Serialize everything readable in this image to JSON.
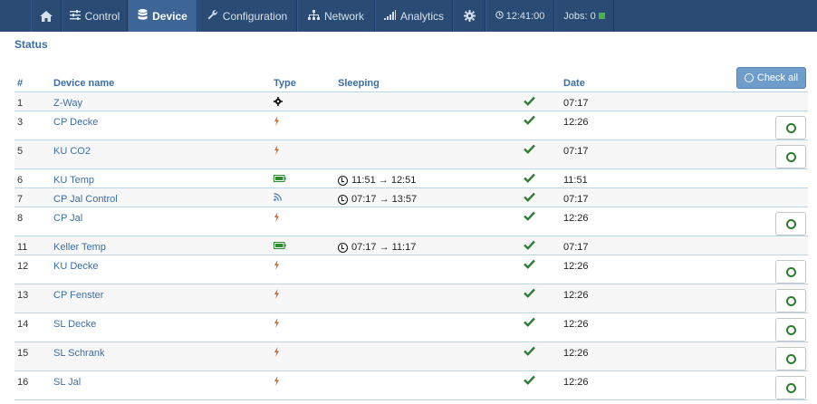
{
  "nav": {
    "home_icon": "home-icon",
    "items": [
      {
        "label": "Control",
        "icon": "sliders-icon"
      },
      {
        "label": "Device",
        "icon": "database-icon"
      },
      {
        "label": "Configuration",
        "icon": "wrench-icon"
      },
      {
        "label": "Network",
        "icon": "network-icon"
      },
      {
        "label": "Analytics",
        "icon": "signal-bars-icon"
      }
    ],
    "settings_icon": "gear-icon",
    "time": "12:41:00",
    "jobs": "Jobs: 0",
    "jobs_indicator_color": "#4caf50"
  },
  "page": {
    "title": "Status",
    "check_all": "Check all"
  },
  "table": {
    "columns": {
      "num": "#",
      "name": "Device name",
      "type": "Type",
      "sleeping": "Sleeping",
      "date": "Date"
    },
    "rows": [
      {
        "num": "1",
        "name": "Z-Way",
        "type": "gear",
        "sleeping": "",
        "date": "07:17"
      },
      {
        "num": "3",
        "name": "CP Decke",
        "type": "mains",
        "sleeping": "",
        "date": "12:26"
      },
      {
        "num": "5",
        "name": "KU CO2",
        "type": "mains",
        "sleeping": "",
        "date": "07:17"
      },
      {
        "num": "6",
        "name": "KU Temp",
        "type": "battery",
        "sleeping": "11:51 → 12:51",
        "date": "11:51"
      },
      {
        "num": "7",
        "name": "CP Jal Control",
        "type": "flirs",
        "sleeping": "07:17 → 13:57",
        "date": "07:17"
      },
      {
        "num": "8",
        "name": "CP Jal",
        "type": "mains",
        "sleeping": "",
        "date": "12:26"
      },
      {
        "num": "11",
        "name": "Keller Temp",
        "type": "battery",
        "sleeping": "07:17 → 11:17",
        "date": "07:17"
      },
      {
        "num": "12",
        "name": "KU Decke",
        "type": "mains",
        "sleeping": "",
        "date": "12:26"
      },
      {
        "num": "13",
        "name": "CP Fenster",
        "type": "mains",
        "sleeping": "",
        "date": "12:26"
      },
      {
        "num": "14",
        "name": "SL Decke",
        "type": "mains",
        "sleeping": "",
        "date": "12:26"
      },
      {
        "num": "15",
        "name": "SL Schrank",
        "type": "mains",
        "sleeping": "",
        "date": "12:26"
      },
      {
        "num": "16",
        "name": "SL Jal",
        "type": "mains",
        "sleeping": "",
        "date": "12:26"
      }
    ]
  }
}
